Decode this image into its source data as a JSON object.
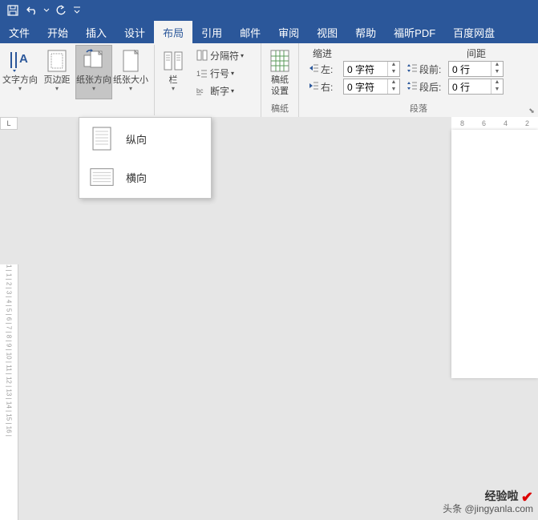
{
  "titlebar": {
    "qat_dropdown": "▾"
  },
  "menu": {
    "file": "文件",
    "home": "开始",
    "insert": "插入",
    "design": "设计",
    "layout": "布局",
    "references": "引用",
    "mailings": "邮件",
    "review": "审阅",
    "view": "视图",
    "help": "帮助",
    "foxit": "福昕PDF",
    "baidu": "百度网盘"
  },
  "ribbon": {
    "page_setup": {
      "text_direction": "文字方向",
      "margins": "页边距",
      "orientation": "纸张方向",
      "size": "纸张大小",
      "columns": "栏",
      "breaks": "分隔符",
      "line_numbers": "行号",
      "hyphenation": "断字"
    },
    "draft": {
      "settings": "稿纸",
      "settings2": "设置",
      "group": "稿纸"
    },
    "paragraph": {
      "indent_header": "缩进",
      "spacing_header": "间距",
      "left": "左:",
      "right": "右:",
      "before": "段前:",
      "after": "段后:",
      "left_val": "0 字符",
      "right_val": "0 字符",
      "before_val": "0 行",
      "after_val": "0 行",
      "group": "段落"
    }
  },
  "dropdown": {
    "portrait": "纵向",
    "landscape": "横向"
  },
  "ruler_h": [
    "8",
    "6",
    "4",
    "2"
  ],
  "ruler_v_text": "1 | 1 | 2 | 3 | 4 | 5 | 6 | 7 | 8 | 9 | 10 | 11 | 12 | 13 | 14 | 15 | 16 |",
  "watermark": {
    "line1": "经验啦",
    "line2": "头条 @jingyanla.com"
  }
}
